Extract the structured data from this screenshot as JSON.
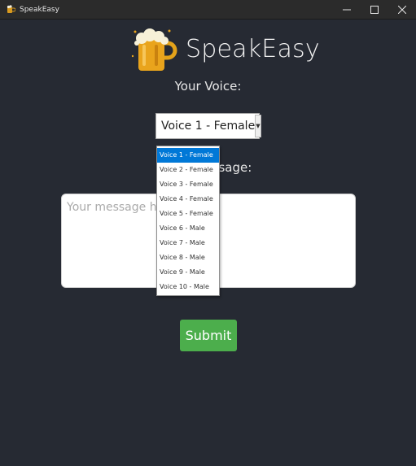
{
  "window": {
    "title": "SpeakEasy",
    "minimize_icon": "minimize-icon",
    "maximize_icon": "maximize-icon",
    "close_icon": "close-icon"
  },
  "app": {
    "logo_icon": "beer-mug-icon",
    "title": "SpeakEasy"
  },
  "voice": {
    "label": "Your Voice:",
    "selected": "Voice 1 - Female",
    "options": [
      "Voice 1 - Female",
      "Voice 2 - Female",
      "Voice 3 - Female",
      "Voice 4 - Female",
      "Voice 5 - Female",
      "Voice 6 - Male",
      "Voice 7 - Male",
      "Voice 8 - Male",
      "Voice 9 - Male",
      "Voice 10 - Male"
    ]
  },
  "message": {
    "label": "Your Message:",
    "value": "",
    "placeholder": "Your message here"
  },
  "submit": {
    "label": "Submit"
  },
  "colors": {
    "background": "#262a33",
    "accent": "#4cae4c",
    "selected_option": "#0078d7"
  }
}
